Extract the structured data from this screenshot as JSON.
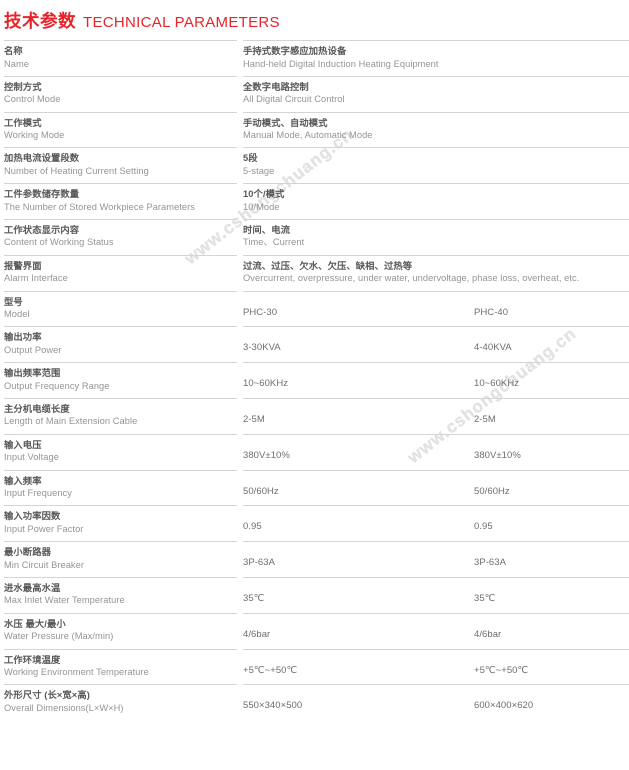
{
  "title": {
    "cn": "技术参数",
    "en": "TECHNICAL PARAMETERS",
    "color": "#E8232A"
  },
  "watermark": {
    "text": "www.cshongchuang.cn"
  },
  "table": {
    "columns": [
      {
        "key": "label",
        "header_cn": "",
        "header_en": ""
      },
      {
        "key": "phc30",
        "header_cn": "",
        "header_en": ""
      },
      {
        "key": "phc40",
        "header_cn": "",
        "header_en": ""
      }
    ],
    "rows": [
      {
        "label_cn": "名称",
        "label_en": "Name",
        "span": true,
        "value_cn": "手持式数字感应加热设备",
        "value_en": "Hand-held Digital Induction Heating Equipment"
      },
      {
        "label_cn": "控制方式",
        "label_en": "Control Mode",
        "span": true,
        "value_cn": "全数字电路控制",
        "value_en": "All Digital Circuit Control"
      },
      {
        "label_cn": "工作模式",
        "label_en": "Working Mode",
        "span": true,
        "value_cn": "手动模式、自动模式",
        "value_en": "Manual Mode, Automatic Mode"
      },
      {
        "label_cn": "加热电流设置段数",
        "label_en": "Number of Heating Current Setting",
        "span": true,
        "value_cn": "5段",
        "value_en": "5-stage"
      },
      {
        "label_cn": "工件参数储存数量",
        "label_en": "The Number of Stored Workpiece Parameters",
        "span": true,
        "value_cn": "10个/模式",
        "value_en": "10/Mode"
      },
      {
        "label_cn": "工作状态显示内容",
        "label_en": "Content of Working Status",
        "span": true,
        "value_cn": "时间、电流",
        "value_en": "Time、Current"
      },
      {
        "label_cn": "报警界面",
        "label_en": "Alarm Interface",
        "span": true,
        "value_cn": "过流、过压、欠水、欠压、缺相、过热等",
        "value_en": "Overcurrent, overpressure, under water, undervoltage, phase loss, overheat, etc."
      },
      {
        "label_cn": "型号",
        "label_en": "Model",
        "span": false,
        "phc30": "PHC-30",
        "phc40": "PHC-40"
      },
      {
        "label_cn": "输出功率",
        "label_en": "Output Power",
        "span": false,
        "phc30": "3-30KVA",
        "phc40": "4-40KVA"
      },
      {
        "label_cn": "输出频率范围",
        "label_en": "Output Frequency Range",
        "span": false,
        "phc30": "10~60KHz",
        "phc40": "10~60KHz"
      },
      {
        "label_cn": "主分机电缆长度",
        "label_en": "Length of Main Extension Cable",
        "span": false,
        "phc30": "2-5M",
        "phc40": "2-5M"
      },
      {
        "label_cn": "输入电压",
        "label_en": "Input Voltage",
        "span": false,
        "phc30": "380V±10%",
        "phc40": "380V±10%"
      },
      {
        "label_cn": "输入频率",
        "label_en": "Input Frequency",
        "span": false,
        "phc30": "50/60Hz",
        "phc40": "50/60Hz"
      },
      {
        "label_cn": "输入功率因数",
        "label_en": "Input Power Factor",
        "span": false,
        "phc30": "0.95",
        "phc40": "0.95"
      },
      {
        "label_cn": "最小断路器",
        "label_en": "Min Circuit Breaker",
        "span": false,
        "phc30": "3P-63A",
        "phc40": "3P-63A"
      },
      {
        "label_cn": "进水最高水温",
        "label_en": "Max Inlet Water Temperature",
        "span": false,
        "phc30": "35℃",
        "phc40": "35℃"
      },
      {
        "label_cn": "水压 最大/最小",
        "label_en": "Water  Pressure (Max/min)",
        "span": false,
        "phc30": "4/6bar",
        "phc40": "4/6bar"
      },
      {
        "label_cn": "工作环境温度",
        "label_en": "Working Environment Temperature",
        "span": false,
        "phc30": "+5℃~+50℃",
        "phc40": "+5℃~+50℃"
      },
      {
        "label_cn": "外形尺寸 (长×宽×高)",
        "label_en": "Overall Dimensions(L×W×H)",
        "span": false,
        "phc30": "550×340×500",
        "phc40": "600×400×620"
      }
    ]
  }
}
